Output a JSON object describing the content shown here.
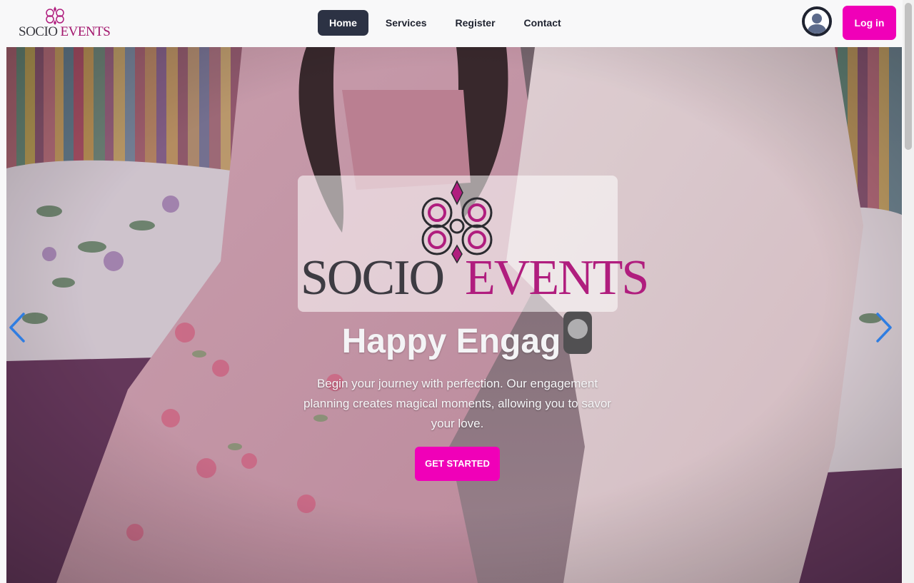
{
  "brand": {
    "word1": "SOCIO",
    "word2": "EVENTS"
  },
  "nav": {
    "items": [
      {
        "label": "Home",
        "active": true
      },
      {
        "label": "Services",
        "active": false
      },
      {
        "label": "Register",
        "active": false
      },
      {
        "label": "Contact",
        "active": false
      }
    ],
    "login_label": "Log in",
    "avatar_icon": "user-avatar-icon"
  },
  "hero": {
    "logo_word1": "SOCIO",
    "logo_word2": "EVENTS",
    "title": "Happy Engag",
    "description": "Begin your journey with perfection. Our engagement planning creates magical moments, allowing you to savor your love.",
    "cta_label": "GET STARTED",
    "prev_icon": "chevron-left-icon",
    "next_icon": "chevron-right-icon"
  },
  "colors": {
    "accent": "#f000b8",
    "nav_active": "#2c3244",
    "brand_magenta": "#a3186e",
    "arrow_blue": "#2f7de1"
  }
}
